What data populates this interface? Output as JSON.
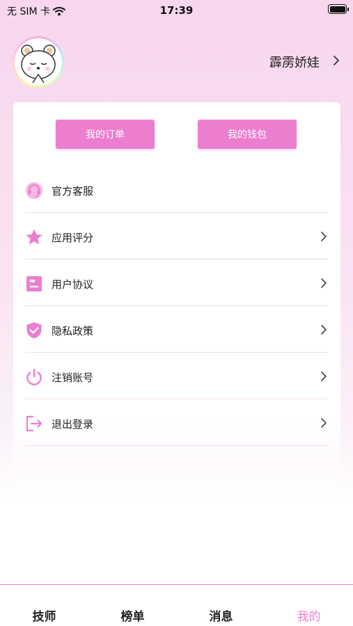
{
  "status_bar": {
    "carrier": "无 SIM 卡",
    "time": "17:39",
    "icons": [
      "wifi-icon",
      "battery-icon"
    ]
  },
  "profile": {
    "username": "霹雳娇娃",
    "avatar": "bear-avatar"
  },
  "quick_actions": [
    {
      "label": "我的订单"
    },
    {
      "label": "我的钱包"
    }
  ],
  "menu": [
    {
      "label": "官方客服",
      "icon": "headset-icon",
      "has_chevron": false
    },
    {
      "label": "应用评分",
      "icon": "star-icon",
      "has_chevron": true
    },
    {
      "label": "用户协议",
      "icon": "document-icon",
      "has_chevron": true
    },
    {
      "label": "隐私政策",
      "icon": "shield-check-icon",
      "has_chevron": true
    },
    {
      "label": "注销账号",
      "icon": "power-icon",
      "has_chevron": true
    },
    {
      "label": "退出登录",
      "icon": "logout-icon",
      "has_chevron": true
    }
  ],
  "tabbar": {
    "tabs": [
      {
        "label": "技师",
        "active": false
      },
      {
        "label": "榜单",
        "active": false
      },
      {
        "label": "消息",
        "active": false
      },
      {
        "label": "我的",
        "active": true
      }
    ]
  },
  "colors": {
    "accent": "#ec7ecf",
    "background_top": "#f7d6ee",
    "divider": "#f3dcec",
    "text": "#222222"
  }
}
